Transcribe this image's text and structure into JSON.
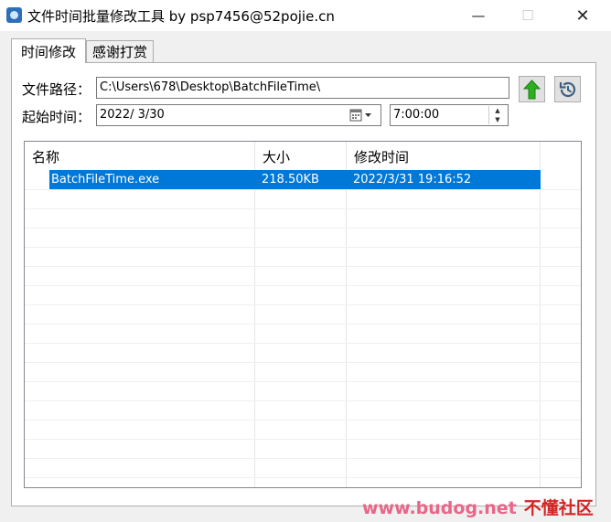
{
  "window": {
    "title": "文件时间批量修改工具 by psp7456@52pojie.cn",
    "min_glyph": "—",
    "max_glyph": "☐",
    "close_glyph": "✕"
  },
  "tabs": [
    {
      "label": "时间修改",
      "active": true
    },
    {
      "label": "感谢打赏",
      "active": false
    }
  ],
  "form": {
    "path_label": "文件路径：",
    "path_value": "C:\\Users\\678\\Desktop\\BatchFileTime\\",
    "start_label": "起始时间：",
    "date_value": "2022/  3/30",
    "time_value": "7:00:00"
  },
  "icons": {
    "up_button": "arrow-up-icon",
    "history_button": "history-icon",
    "calendar": "calendar-icon"
  },
  "list": {
    "columns": [
      "名称",
      "大小",
      "修改时间"
    ],
    "rows": [
      {
        "name": "BatchFileTime.exe",
        "size": "218.50KB",
        "modified": "2022/3/31 19:16:52",
        "selected": true
      }
    ]
  },
  "watermark": {
    "url": "www.budog.net",
    "text": "不懂社区"
  },
  "colors": {
    "selection": "#0078d7",
    "up_arrow": "#2bb11f",
    "history_icon": "#3d5f80"
  }
}
